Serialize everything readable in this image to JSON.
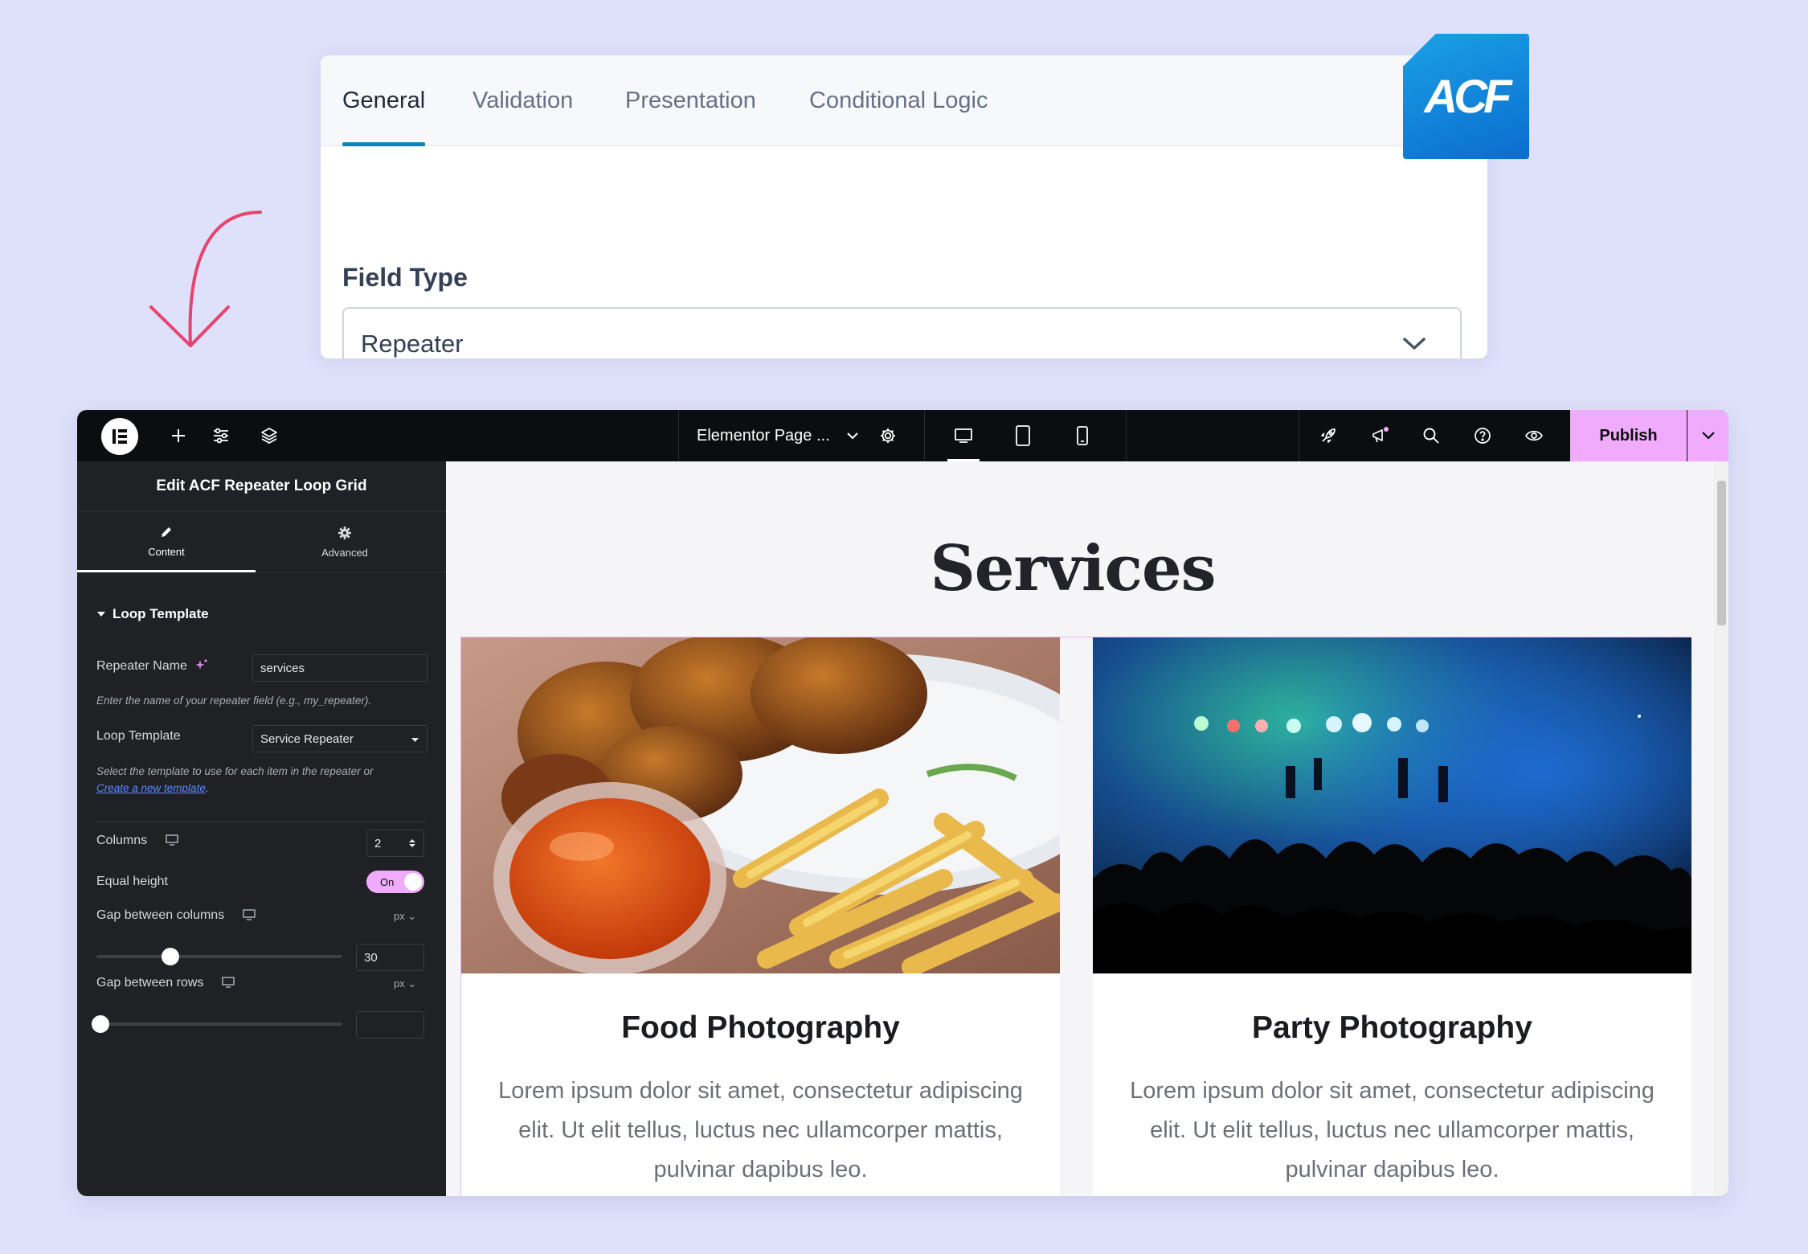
{
  "acf": {
    "tabs": [
      {
        "label": "General",
        "active": true
      },
      {
        "label": "Validation",
        "active": false
      },
      {
        "label": "Presentation",
        "active": false
      },
      {
        "label": "Conditional Logic",
        "active": false
      }
    ],
    "field_type_label": "Field Type",
    "field_type_value": "Repeater",
    "logo_text": "ACF",
    "accent_color": "#0783be"
  },
  "topbar": {
    "page_title": "Elementor Page ...",
    "publish_label": "Publish",
    "publish_color": "#f0abfc",
    "icons": [
      "elementor-logo-icon",
      "add-icon",
      "settings-sliders-icon",
      "layers-icon",
      "page-settings-icon",
      "desktop-icon",
      "tablet-icon",
      "mobile-icon",
      "rocket-icon",
      "notifications-icon",
      "search-icon",
      "help-icon",
      "preview-eye-icon",
      "chevron-down-icon"
    ]
  },
  "panel": {
    "title": "Edit ACF Repeater Loop Grid",
    "tab_content": "Content",
    "tab_advanced": "Advanced",
    "section_title": "Loop Template",
    "repeater_name_label": "Repeater Name",
    "repeater_name_value": "services",
    "repeater_name_note": "Enter the name of your repeater field (e.g., my_repeater).",
    "loop_template_label": "Loop Template",
    "loop_template_value": "Service Repeater",
    "loop_template_note": "Select the template to use for each item in the repeater or",
    "loop_template_link": "Create a new template",
    "loop_template_link_suffix": ".",
    "columns_label": "Columns",
    "columns_value": "2",
    "equal_height_label": "Equal height",
    "equal_height_state": "On",
    "gap_columns_label": "Gap between columns",
    "gap_columns_unit": "px",
    "gap_columns_value": "30",
    "gap_columns_fraction": 0.3,
    "gap_rows_label": "Gap between rows",
    "gap_rows_unit": "px",
    "gap_rows_value": "",
    "gap_rows_fraction": 0
  },
  "canvas": {
    "heading": "Services",
    "cards": [
      {
        "title": "Food Photography",
        "text": "Lorem ipsum dolor sit amet, consectetur adipiscing elit. Ut elit tellus, luctus nec ullamcorper mattis, pulvinar dapibus leo.",
        "image": "food-photo-wings-and-fries"
      },
      {
        "title": "Party Photography",
        "text": "Lorem ipsum dolor sit amet, consectetur adipiscing elit. Ut elit tellus, luctus nec ullamcorper mattis, pulvinar dapibus leo.",
        "image": "concert-crowd-stage-lights"
      }
    ]
  }
}
